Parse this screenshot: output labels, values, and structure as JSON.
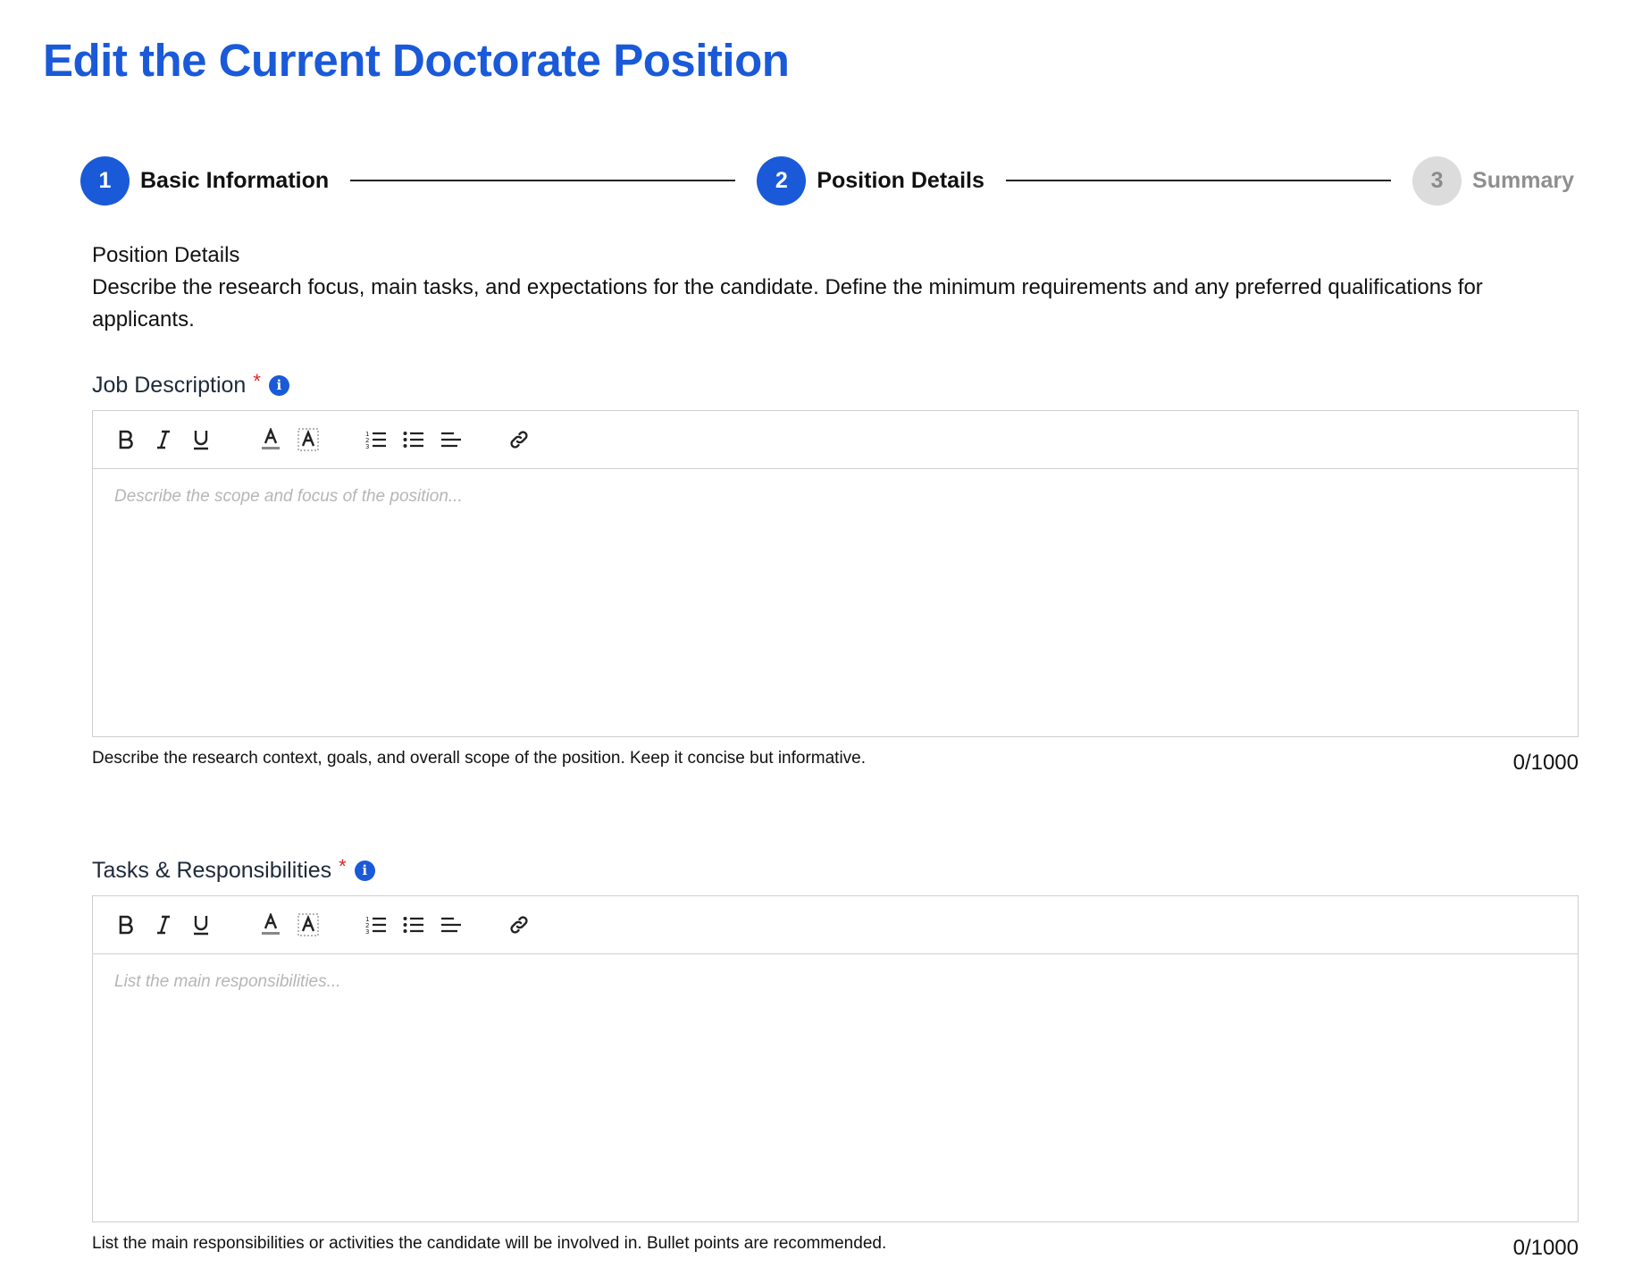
{
  "page": {
    "title": "Edit the Current Doctorate Position"
  },
  "stepper": {
    "steps": [
      {
        "number": "1",
        "label": "Basic Information",
        "state": "complete"
      },
      {
        "number": "2",
        "label": "Position Details",
        "state": "active"
      },
      {
        "number": "3",
        "label": "Summary",
        "state": "inactive"
      }
    ]
  },
  "section": {
    "title": "Position Details",
    "description": "Describe the research focus, main tasks, and expectations for the candidate. Define the minimum requirements and any preferred qualifications for applicants."
  },
  "toolbar_icons": [
    "bold-icon",
    "italic-icon",
    "underline-icon",
    "text-color-icon",
    "highlight-icon",
    "ordered-list-icon",
    "bullet-list-icon",
    "align-icon",
    "link-icon"
  ],
  "fields": {
    "job_description": {
      "label": "Job Description",
      "required_mark": "*",
      "placeholder": "Describe the scope and focus of the position...",
      "hint": "Describe the research context, goals, and overall scope of the position. Keep it concise but informative.",
      "counter": "0/1000"
    },
    "tasks": {
      "label": "Tasks & Responsibilities",
      "required_mark": "*",
      "placeholder": "List the main responsibilities...",
      "hint": "List the main responsibilities or activities the candidate will be involved in. Bullet points are recommended.",
      "counter": "0/1000"
    }
  },
  "colors": {
    "accent": "#1a5ad8",
    "required": "#e02424",
    "inactive_step": "#dcdcdc",
    "border": "#cfcfcf"
  }
}
